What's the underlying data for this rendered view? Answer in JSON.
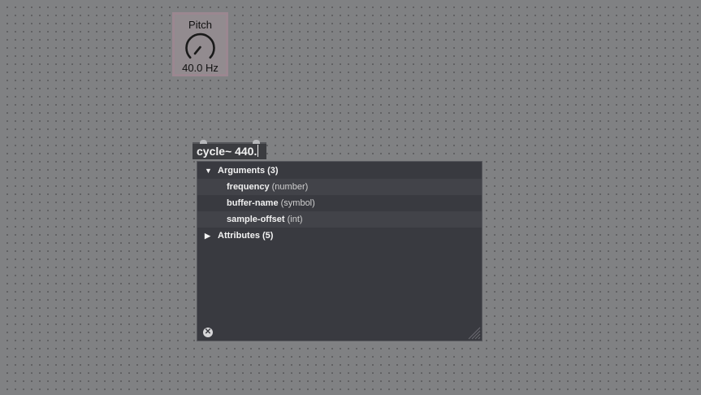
{
  "dial": {
    "label": "Pitch",
    "value": "40.0 Hz"
  },
  "object_box": {
    "text": "cycle~ 440."
  },
  "reference_popup": {
    "arguments_header": "Arguments (3)",
    "arguments": [
      {
        "name": "frequency",
        "type": "(number)"
      },
      {
        "name": "buffer-name",
        "type": "(symbol)"
      },
      {
        "name": "sample-offset",
        "type": "(int)"
      }
    ],
    "attributes_header": "Attributes (5)",
    "arrows": {
      "expanded": "▼",
      "collapsed": "▶"
    },
    "close_glyph": "✕"
  }
}
